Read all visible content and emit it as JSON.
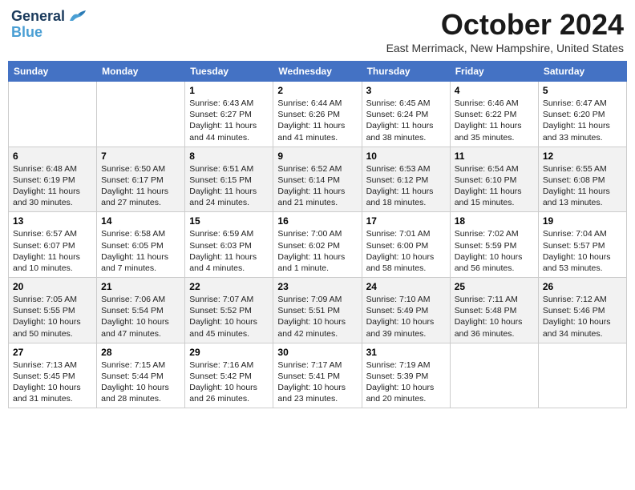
{
  "header": {
    "logo_line1": "General",
    "logo_line2": "Blue",
    "month": "October 2024",
    "location": "East Merrimack, New Hampshire, United States"
  },
  "weekdays": [
    "Sunday",
    "Monday",
    "Tuesday",
    "Wednesday",
    "Thursday",
    "Friday",
    "Saturday"
  ],
  "weeks": [
    [
      {
        "day": "",
        "info": ""
      },
      {
        "day": "",
        "info": ""
      },
      {
        "day": "1",
        "info": "Sunrise: 6:43 AM\nSunset: 6:27 PM\nDaylight: 11 hours and 44 minutes."
      },
      {
        "day": "2",
        "info": "Sunrise: 6:44 AM\nSunset: 6:26 PM\nDaylight: 11 hours and 41 minutes."
      },
      {
        "day": "3",
        "info": "Sunrise: 6:45 AM\nSunset: 6:24 PM\nDaylight: 11 hours and 38 minutes."
      },
      {
        "day": "4",
        "info": "Sunrise: 6:46 AM\nSunset: 6:22 PM\nDaylight: 11 hours and 35 minutes."
      },
      {
        "day": "5",
        "info": "Sunrise: 6:47 AM\nSunset: 6:20 PM\nDaylight: 11 hours and 33 minutes."
      }
    ],
    [
      {
        "day": "6",
        "info": "Sunrise: 6:48 AM\nSunset: 6:19 PM\nDaylight: 11 hours and 30 minutes."
      },
      {
        "day": "7",
        "info": "Sunrise: 6:50 AM\nSunset: 6:17 PM\nDaylight: 11 hours and 27 minutes."
      },
      {
        "day": "8",
        "info": "Sunrise: 6:51 AM\nSunset: 6:15 PM\nDaylight: 11 hours and 24 minutes."
      },
      {
        "day": "9",
        "info": "Sunrise: 6:52 AM\nSunset: 6:14 PM\nDaylight: 11 hours and 21 minutes."
      },
      {
        "day": "10",
        "info": "Sunrise: 6:53 AM\nSunset: 6:12 PM\nDaylight: 11 hours and 18 minutes."
      },
      {
        "day": "11",
        "info": "Sunrise: 6:54 AM\nSunset: 6:10 PM\nDaylight: 11 hours and 15 minutes."
      },
      {
        "day": "12",
        "info": "Sunrise: 6:55 AM\nSunset: 6:08 PM\nDaylight: 11 hours and 13 minutes."
      }
    ],
    [
      {
        "day": "13",
        "info": "Sunrise: 6:57 AM\nSunset: 6:07 PM\nDaylight: 11 hours and 10 minutes."
      },
      {
        "day": "14",
        "info": "Sunrise: 6:58 AM\nSunset: 6:05 PM\nDaylight: 11 hours and 7 minutes."
      },
      {
        "day": "15",
        "info": "Sunrise: 6:59 AM\nSunset: 6:03 PM\nDaylight: 11 hours and 4 minutes."
      },
      {
        "day": "16",
        "info": "Sunrise: 7:00 AM\nSunset: 6:02 PM\nDaylight: 11 hours and 1 minute."
      },
      {
        "day": "17",
        "info": "Sunrise: 7:01 AM\nSunset: 6:00 PM\nDaylight: 10 hours and 58 minutes."
      },
      {
        "day": "18",
        "info": "Sunrise: 7:02 AM\nSunset: 5:59 PM\nDaylight: 10 hours and 56 minutes."
      },
      {
        "day": "19",
        "info": "Sunrise: 7:04 AM\nSunset: 5:57 PM\nDaylight: 10 hours and 53 minutes."
      }
    ],
    [
      {
        "day": "20",
        "info": "Sunrise: 7:05 AM\nSunset: 5:55 PM\nDaylight: 10 hours and 50 minutes."
      },
      {
        "day": "21",
        "info": "Sunrise: 7:06 AM\nSunset: 5:54 PM\nDaylight: 10 hours and 47 minutes."
      },
      {
        "day": "22",
        "info": "Sunrise: 7:07 AM\nSunset: 5:52 PM\nDaylight: 10 hours and 45 minutes."
      },
      {
        "day": "23",
        "info": "Sunrise: 7:09 AM\nSunset: 5:51 PM\nDaylight: 10 hours and 42 minutes."
      },
      {
        "day": "24",
        "info": "Sunrise: 7:10 AM\nSunset: 5:49 PM\nDaylight: 10 hours and 39 minutes."
      },
      {
        "day": "25",
        "info": "Sunrise: 7:11 AM\nSunset: 5:48 PM\nDaylight: 10 hours and 36 minutes."
      },
      {
        "day": "26",
        "info": "Sunrise: 7:12 AM\nSunset: 5:46 PM\nDaylight: 10 hours and 34 minutes."
      }
    ],
    [
      {
        "day": "27",
        "info": "Sunrise: 7:13 AM\nSunset: 5:45 PM\nDaylight: 10 hours and 31 minutes."
      },
      {
        "day": "28",
        "info": "Sunrise: 7:15 AM\nSunset: 5:44 PM\nDaylight: 10 hours and 28 minutes."
      },
      {
        "day": "29",
        "info": "Sunrise: 7:16 AM\nSunset: 5:42 PM\nDaylight: 10 hours and 26 minutes."
      },
      {
        "day": "30",
        "info": "Sunrise: 7:17 AM\nSunset: 5:41 PM\nDaylight: 10 hours and 23 minutes."
      },
      {
        "day": "31",
        "info": "Sunrise: 7:19 AM\nSunset: 5:39 PM\nDaylight: 10 hours and 20 minutes."
      },
      {
        "day": "",
        "info": ""
      },
      {
        "day": "",
        "info": ""
      }
    ]
  ]
}
